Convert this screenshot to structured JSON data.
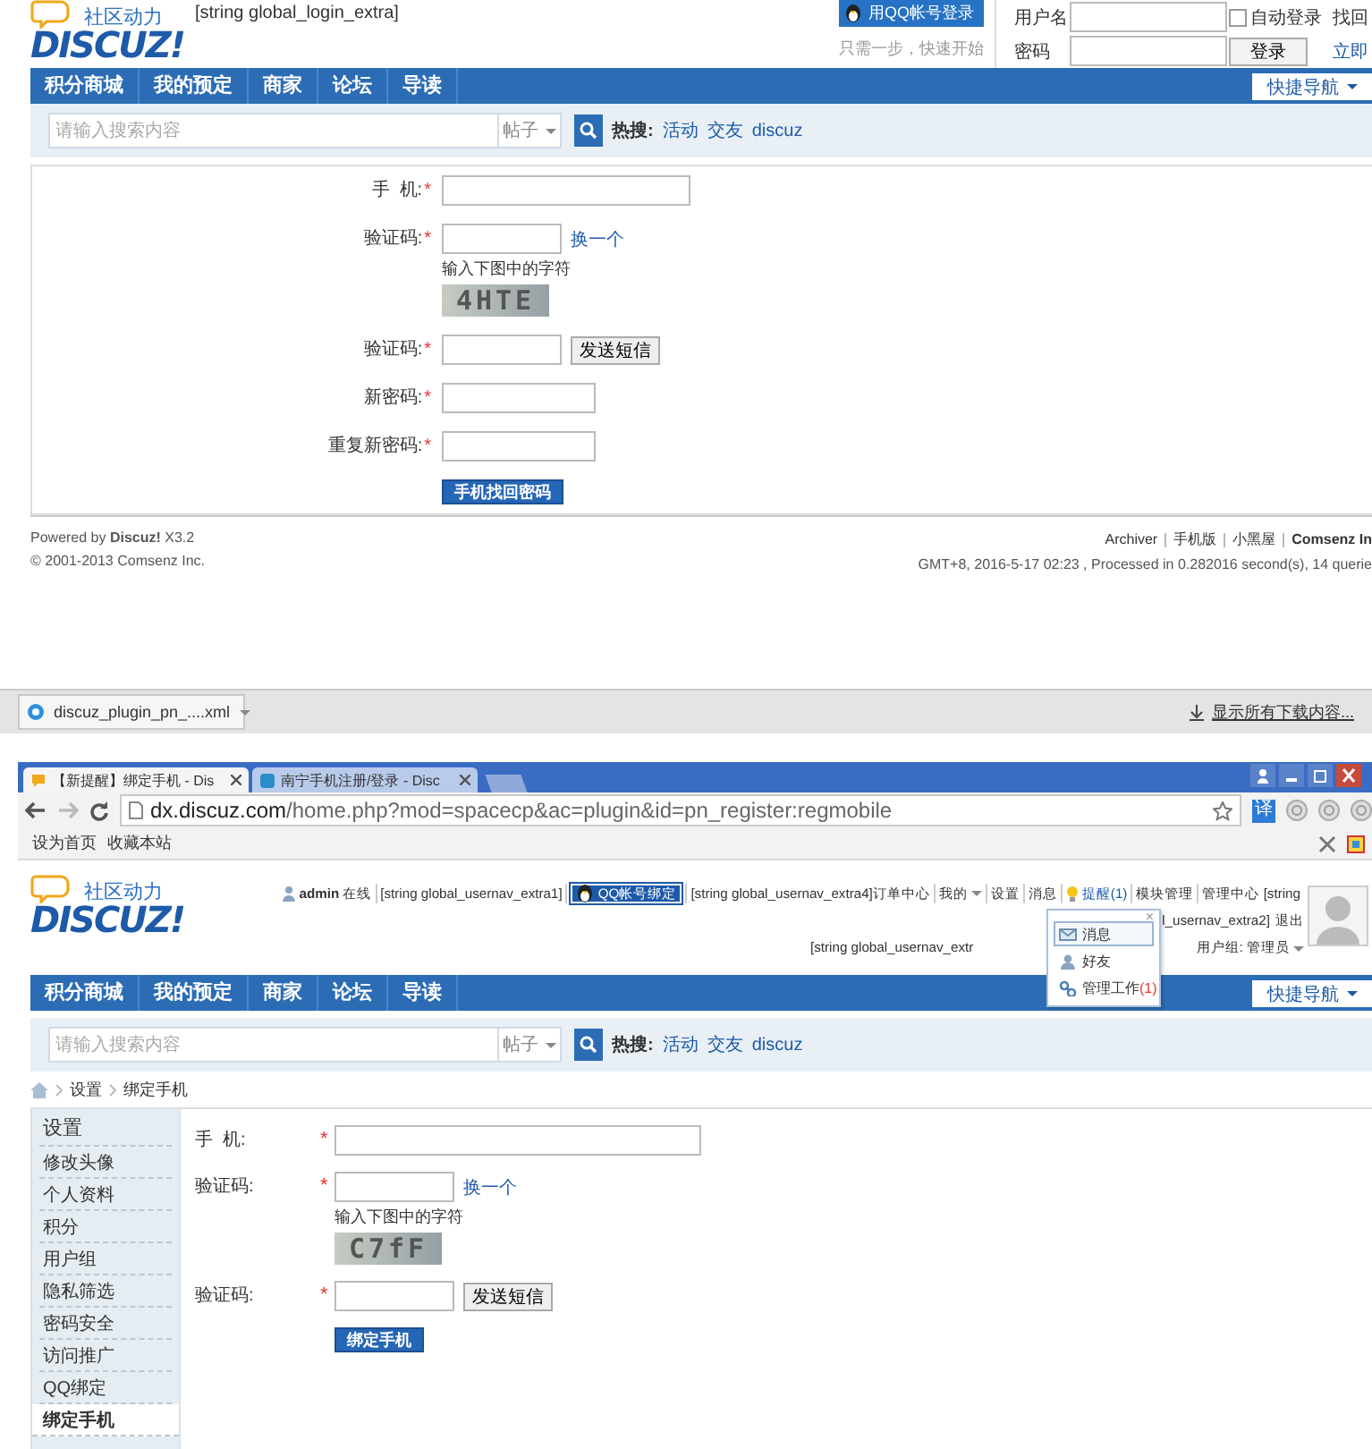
{
  "page_top": {
    "logo": {
      "tagline": "社区动力",
      "wordmark": "DISCUZ!"
    },
    "login_extra": "[string global_login_extra]",
    "qq_login": {
      "label": "用QQ帐号登录",
      "note": "只需一步，快速开始"
    },
    "login_form": {
      "username_label": "用户名",
      "password_label": "密码",
      "auto_login": {
        "label": "自动登录",
        "checked": false
      },
      "login_button": "登录",
      "forgot_link": "找回",
      "register_link": "立即"
    },
    "nav": {
      "items": [
        "积分商城",
        "我的预定",
        "商家",
        "论坛",
        "导读"
      ],
      "quick_nav": "快捷导航"
    },
    "search": {
      "placeholder": "请输入搜索内容",
      "scope": "帖子",
      "hot_label": "热搜:",
      "hot": [
        "活动",
        "交友",
        "discuz"
      ]
    },
    "form": {
      "fields": [
        {
          "kind": "phone",
          "label": "手  机:",
          "mark": "*"
        },
        {
          "kind": "captcha",
          "label": "验证码:",
          "mark": "*",
          "refresh": "换一个",
          "hint": "输入下图中的字符",
          "captcha_text": "4HTE"
        },
        {
          "kind": "sms",
          "label": "验证码:",
          "mark": "*",
          "send_button": "发送短信"
        },
        {
          "kind": "password",
          "label": "新密码:",
          "mark": "*"
        },
        {
          "kind": "password",
          "label": "重复新密码:",
          "mark": "*"
        }
      ],
      "submit": "手机找回密码"
    },
    "footer": {
      "powered_by": "Powered by **Discuz!** X3.2",
      "copyright": "© 2001-2013 Comsenz Inc.",
      "links": [
        {
          "label": "Archiver",
          "strong": false
        },
        {
          "label": "手机版",
          "strong": false
        },
        {
          "label": "小黑屋",
          "strong": false
        },
        {
          "label": "Comsenz In",
          "strong": true
        }
      ],
      "timing": "GMT+8, 2016-5-17 02:23 , Processed in 0.282016 second(s), 14 querie"
    }
  },
  "download_bar": {
    "file": "discuz_plugin_pn_....xml",
    "show_all": "显示所有下载内容..."
  },
  "browser": {
    "tabs": [
      {
        "title": "【新提醒】绑定手机 - Dis",
        "selected": true
      },
      {
        "title": "南宁手机注册/登录 - Disc",
        "selected": false
      }
    ],
    "url_host": "dx.discuz.com",
    "url_path": "/home.php?mod=spacecp&ac=plugin&id=pn_register:regmobile",
    "translate": "译",
    "bookmarks": [
      "设为首页",
      "收藏本站"
    ]
  },
  "page_bottom": {
    "logo": {
      "tagline": "社区动力",
      "wordmark": "DISCUZ!"
    },
    "user_nav": [
      {
        "kind": "user",
        "label": "admin",
        "status": "在线"
      },
      {
        "kind": "text",
        "label": "[string global_usernav_extra1]"
      },
      {
        "kind": "qq",
        "label": "QQ帐号绑定"
      },
      {
        "kind": "text",
        "label": "[string global_usernav_extra4]订单中心"
      },
      {
        "kind": "menu",
        "label": "我的"
      },
      {
        "kind": "text",
        "label": "设置"
      },
      {
        "kind": "text",
        "label": "消息"
      },
      {
        "kind": "notice",
        "label": "提醒(1)"
      },
      {
        "kind": "text",
        "label": "模块管理"
      },
      {
        "kind": "text",
        "label": "管理中心 [string"
      }
    ],
    "user_nav_row2": [
      "l_usernav_extra2]",
      "退出"
    ],
    "usernav_extra": "[string global_usernav_extr",
    "user_group": "用户组: 管理员",
    "notice_menu": {
      "close": "×",
      "items": [
        {
          "kind": "message",
          "label": "消息",
          "selected": true
        },
        {
          "kind": "friend",
          "label": "好友",
          "selected": false
        },
        {
          "kind": "manage",
          "label": "管理工作",
          "count": "(1)",
          "selected": false
        }
      ]
    },
    "nav": {
      "items": [
        "积分商城",
        "我的预定",
        "商家",
        "论坛",
        "导读"
      ],
      "quick_nav": "快捷导航"
    },
    "search": {
      "placeholder": "请输入搜索内容",
      "scope": "帖子",
      "hot_label": "热搜:",
      "hot": [
        "活动",
        "交友",
        "discuz"
      ]
    },
    "breadcrumb": [
      "设置",
      "绑定手机"
    ],
    "sidebar": {
      "title": "设置",
      "items": [
        {
          "label": "修改头像",
          "selected": false
        },
        {
          "label": "个人资料",
          "selected": false
        },
        {
          "label": "积分",
          "selected": false
        },
        {
          "label": "用户组",
          "selected": false
        },
        {
          "label": "隐私筛选",
          "selected": false
        },
        {
          "label": "密码安全",
          "selected": false
        },
        {
          "label": "访问推广",
          "selected": false
        },
        {
          "label": "QQ绑定",
          "selected": false
        },
        {
          "label": "绑定手机",
          "selected": true
        }
      ]
    },
    "form": {
      "fields": [
        {
          "kind": "phone",
          "label": "手  机:",
          "mark": "*"
        },
        {
          "kind": "captcha",
          "label": "验证码:",
          "mark": "*",
          "refresh": "换一个",
          "hint": "输入下图中的字符",
          "captcha_text": "C7fF"
        },
        {
          "kind": "sms",
          "label": "验证码:",
          "mark": "*",
          "send_button": "发送短信"
        }
      ],
      "submit": "绑定手机"
    }
  }
}
